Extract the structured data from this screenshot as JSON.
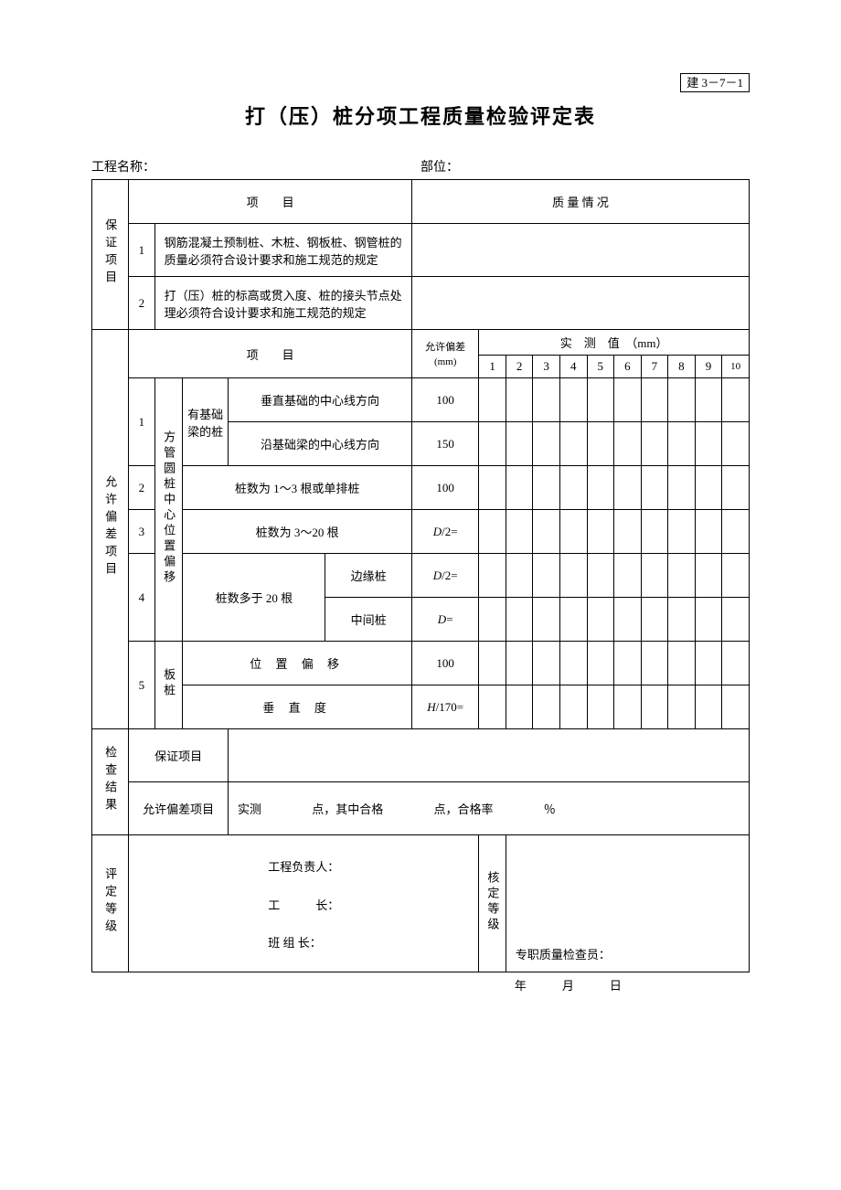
{
  "doc_code": "建 3－7－1",
  "title": "打（压）桩分项工程质量检验评定表",
  "header": {
    "project_label": "工程名称：",
    "unit_label": "部位："
  },
  "guarantee": {
    "section_label": "保证项目",
    "col_project": "项　　目",
    "col_quality": "质 量 情 况",
    "rows": [
      {
        "no": "1",
        "text": "钢筋混凝土预制桩、木桩、钢板桩、钢管桩的质量必须符合设计要求和施工规范的规定"
      },
      {
        "no": "2",
        "text": "打（压）桩的标高或贯入度、桩的接头节点处理必须符合设计要求和施工规范的规定"
      }
    ]
  },
  "deviation": {
    "section_label": "允许偏差项目",
    "col_project": "项　　目",
    "col_tolerance": "允许偏差",
    "col_tolerance_unit": "(mm)",
    "col_measured": "实　测　值　（mm）",
    "numbers": [
      "1",
      "2",
      "3",
      "4",
      "5",
      "6",
      "7",
      "8",
      "9",
      "10"
    ],
    "group_label": "方管圆桩中心位置偏移",
    "rows": [
      {
        "no": "1",
        "sub_label": "有基础梁的桩",
        "text": "垂直基础的中心线方向",
        "tol": "100"
      },
      {
        "no": "",
        "sub_label": "",
        "text": "沿基础梁的中心线方向",
        "tol": "150"
      },
      {
        "no": "2",
        "text": "桩数为 1～3 根或单排桩",
        "tol": "100"
      },
      {
        "no": "3",
        "text": "桩数为 3～20 根",
        "tol": "D/2="
      },
      {
        "no": "4",
        "text": "桩数多于 20 根",
        "sub1": "边缘桩",
        "tol1": "D/2=",
        "sub2": "中间桩",
        "tol2": "D="
      }
    ],
    "row5": {
      "no": "5",
      "label": "板桩",
      "r1": "位 置 偏 移",
      "t1": "100",
      "r2": "垂 直 度",
      "t2": "H/170="
    }
  },
  "check": {
    "section_label": "检查结果",
    "row1_label": "保证项目",
    "row2_label": "允许偏差项目",
    "row2_text_1": "实测",
    "row2_text_2": "点，其中合格",
    "row2_text_3": "点，合格率",
    "row2_text_4": "％"
  },
  "eval": {
    "section_label": "评定等级",
    "line1": "工程负责人：",
    "line2": "工　　　长：",
    "line3": "班 组 长：",
    "verify_label": "核定等级",
    "inspector": "专职质量检查员："
  },
  "date": {
    "y": "年",
    "m": "月",
    "d": "日"
  }
}
